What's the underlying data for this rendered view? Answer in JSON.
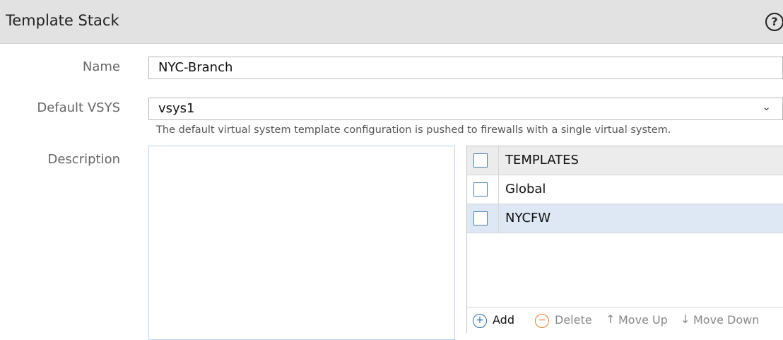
{
  "header": {
    "title": "Template Stack",
    "help_icon": "question-circle-icon",
    "help_glyph": "?"
  },
  "form": {
    "name": {
      "label": "Name",
      "value": "NYC-Branch"
    },
    "default_vsys": {
      "label": "Default VSYS",
      "value": "vsys1",
      "chevron_glyph": "⌄",
      "help": "The default virtual system template configuration is pushed to firewalls with a single virtual system."
    },
    "description": {
      "label": "Description",
      "value": ""
    }
  },
  "templates_grid": {
    "column_header": "TEMPLATES",
    "rows": [
      {
        "name": "Global",
        "checked": false,
        "selected": false
      },
      {
        "name": "NYCFW",
        "checked": false,
        "selected": true
      }
    ],
    "toolbar": {
      "add": "Add",
      "add_glyph": "+",
      "delete": "Delete",
      "delete_glyph": "−",
      "move_up": "Move Up",
      "move_up_glyph": "↑",
      "move_down": "Move Down",
      "move_down_glyph": "↓"
    }
  },
  "colors": {
    "header_bg": "#e2e2e2",
    "accent_blue": "#2f6db5",
    "delete_orange": "#e67e2e",
    "selected_row": "#dde8f4",
    "disabled_text": "#888888"
  }
}
